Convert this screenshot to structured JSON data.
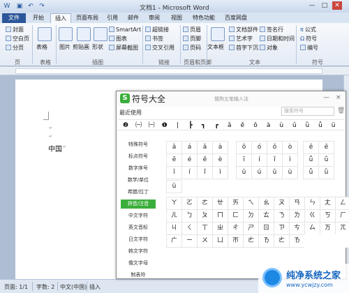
{
  "window": {
    "title": "文档1 - Microsoft Word"
  },
  "tabs": [
    "开始",
    "插入",
    "页面布局",
    "引用",
    "邮件",
    "审阅",
    "视图",
    "特色功能",
    "百度网盘"
  ],
  "file_tab": "文件",
  "ribbon": {
    "page_items": [
      "封面",
      "空白页",
      "分页"
    ],
    "table": "表格",
    "pictures": "图片",
    "clipart": "剪贴画",
    "shapes": "形状",
    "smartart": "SmartArt",
    "chart": "图表",
    "screenshot": "屏幕截图",
    "link_items": [
      "超链接",
      "书签",
      "交叉引用"
    ],
    "hf_items": [
      "页眉",
      "页脚",
      "页码"
    ],
    "textbox": "文本框",
    "text_items": [
      "文档部件",
      "艺术字",
      "首字下沉"
    ],
    "text_items2": [
      "签名行",
      "日期和时间",
      "对象"
    ],
    "sym_items": [
      "公式",
      "符号",
      "编号"
    ],
    "groups": [
      "页",
      "表格",
      "插图",
      "链接",
      "页眉和页脚",
      "文本",
      "符号"
    ]
  },
  "document": {
    "text": "中国"
  },
  "statusbar": {
    "page": "页面: 1/1",
    "words": "字数: 2",
    "language": "中文(中国)",
    "mode": "插入"
  },
  "panel": {
    "logo": "S",
    "title": "符号大全",
    "subtitle": "搜狗五笔输入法",
    "close": "×",
    "minimize": "—",
    "recent_label": "最近使用",
    "search_placeholder": "搜索符号",
    "recent": [
      "❷",
      "㈠",
      "㈠",
      "❶",
      "|",
      "┣",
      "┓",
      "┏",
      "ǎ",
      "ě",
      "ǒ",
      "à",
      "ù",
      "ǔ",
      "ǜ",
      "ǚ",
      "ü"
    ],
    "categories": [
      "特殊符号",
      "标点符号",
      "数字序号",
      "数学/单位",
      "希腊/拉丁",
      "拼音/注音",
      "中文字符",
      "英文音标",
      "日文字符",
      "韩文字符",
      "俄文字母",
      "制表符"
    ],
    "active_category": "拼音/注音",
    "pinyin_grid1": [
      [
        "ā",
        "á",
        "ǎ",
        "à"
      ],
      [
        "ē",
        "é",
        "ě",
        "è"
      ],
      [
        "ī",
        "í",
        "ǐ",
        "ì"
      ]
    ],
    "pinyin_grid2": [
      [
        "ō",
        "ó",
        "ǒ",
        "ò"
      ],
      [
        "ī",
        "í",
        "ǐ",
        "ì"
      ],
      [
        "ū",
        "ú",
        "ǔ",
        "ù"
      ]
    ],
    "pinyin_grid3": [
      [
        "ê",
        "ê"
      ],
      [
        "ǖ",
        "ǘ"
      ],
      [
        "ǚ",
        "ǜ"
      ]
    ],
    "pinyin_extra": [
      "ü"
    ],
    "zhuyin_grid": [
      [
        "ㄚ",
        "ㄛ",
        "ㄜ",
        "ㄝ",
        "ㄞ",
        "ㄟ",
        "ㄠ",
        "ㄡ",
        "ㄢ",
        "ㄣ",
        "ㄤ",
        "ㄥ"
      ],
      [
        "ㄦ",
        "ㄅ",
        "ㄆ",
        "ㄇ",
        "ㄈ",
        "ㄉ",
        "ㄊ",
        "ㄋ",
        "ㄌ",
        "ㄍ",
        "ㄎ",
        "ㄏ"
      ],
      [
        "ㄐ",
        "ㄑ",
        "ㄒ",
        "ㄓ",
        "ㄔ",
        "ㄕ",
        "ㄖ",
        "ㄗ",
        "ㄘ",
        "ㄙ",
        "ㄪ",
        "ㄫ"
      ],
      [
        "ㄬ",
        "ㄧ",
        "ㄨ",
        "ㄩ",
        "ㄭ",
        "ㄮ",
        "ㄯ",
        "ㄮ",
        "ㄯ",
        "",
        "",
        ""
      ]
    ]
  },
  "watermark": {
    "title": "纯净系统之家",
    "url": "www.ycwjzy.com"
  }
}
